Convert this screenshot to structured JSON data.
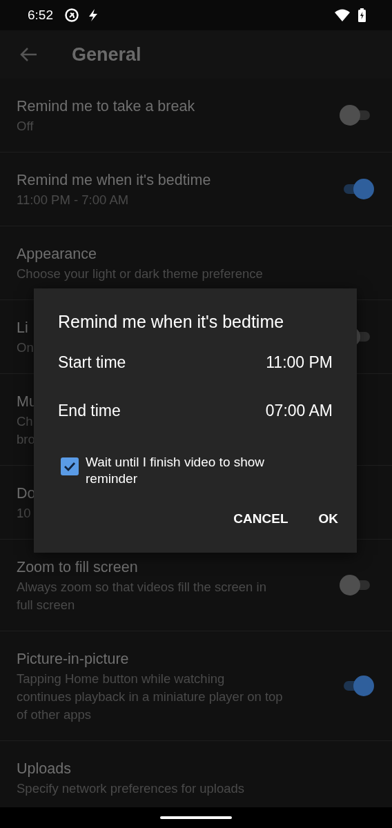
{
  "status_bar": {
    "time": "6:52"
  },
  "app_bar": {
    "title": "General"
  },
  "settings": [
    {
      "title": "Remind me to take a break",
      "subtitle_lines": [
        "Off"
      ],
      "kind": "toggle",
      "on": false
    },
    {
      "title": "Remind me when it's bedtime",
      "subtitle_lines": [
        "11:00 PM - 7:00 AM"
      ],
      "kind": "toggle",
      "on": true
    },
    {
      "title": "Appearance",
      "subtitle_lines": [
        "Choose your light or dark theme preference"
      ],
      "kind": "plain"
    },
    {
      "title": "Li",
      "subtitle_lines": [
        "On"
      ],
      "kind": "toggle",
      "on": false
    },
    {
      "title": "Mu",
      "subtitle_lines": [
        "Ch",
        "bro"
      ],
      "kind": "plain"
    },
    {
      "title": "Do",
      "subtitle_lines": [
        "10"
      ],
      "kind": "plain"
    },
    {
      "title": "Zoom to fill screen",
      "subtitle_lines": [
        "Always zoom so that videos fill the screen in",
        "full screen"
      ],
      "kind": "toggle",
      "on": false
    },
    {
      "title": "Picture-in-picture",
      "subtitle_lines": [
        "Tapping Home button while watching",
        "continues playback in a miniature player on top",
        "of other apps"
      ],
      "kind": "toggle",
      "on": true
    },
    {
      "title": "Uploads",
      "subtitle_lines": [
        "Specify network preferences for uploads"
      ],
      "kind": "plain"
    }
  ],
  "dialog": {
    "title": "Remind me when it's bedtime",
    "fields": [
      {
        "label": "Start time",
        "value": "11:00 PM"
      },
      {
        "label": "End time",
        "value": "07:00 AM"
      }
    ],
    "checkbox": {
      "label": "Wait until I finish video to show reminder",
      "checked": true
    },
    "buttons": [
      "CANCEL",
      "OK"
    ]
  }
}
